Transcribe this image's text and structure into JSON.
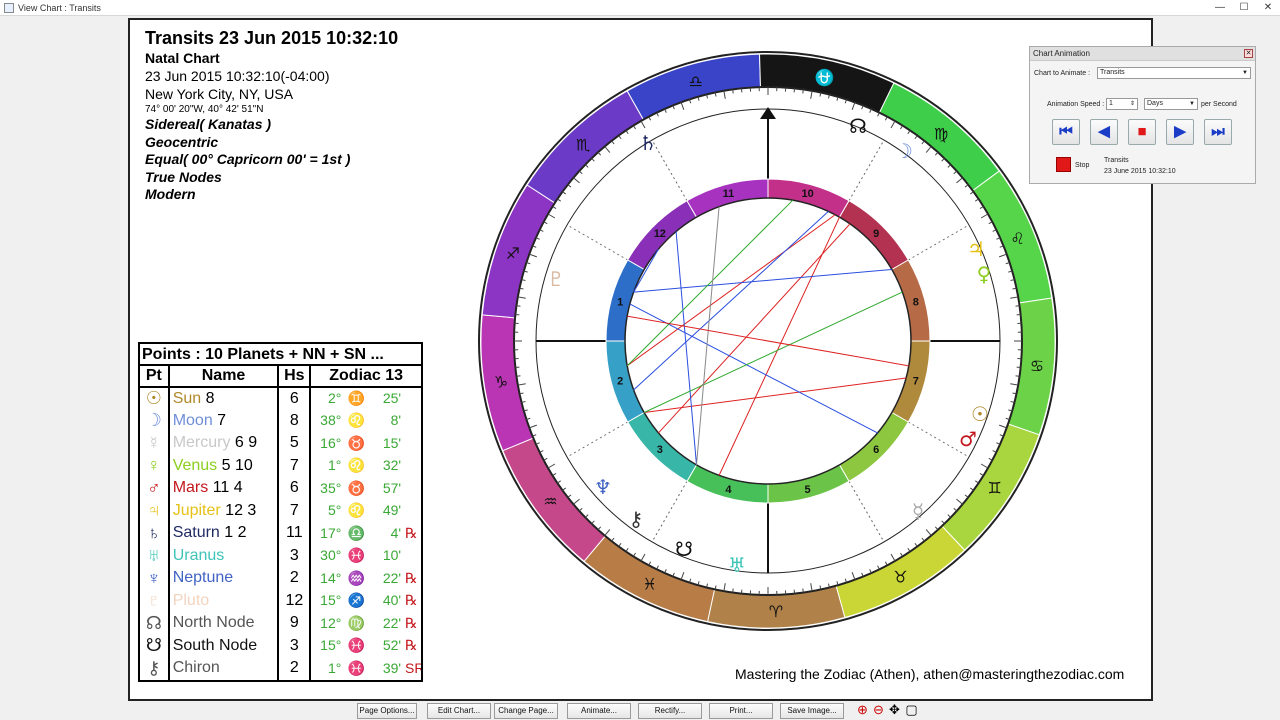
{
  "window": {
    "title": "View Chart : Transits",
    "minimize": "—",
    "maximize": "☐",
    "close": "✕"
  },
  "header": {
    "title": "Transits 23 Jun 2015 10:32:10",
    "subtitle": "Natal Chart",
    "datetime": "23 Jun 2015 10:32:10(-04:00)",
    "location": "New York City, NY, USA",
    "coords": "74° 00' 20\"W, 40° 42' 51\"N",
    "zodiac": "Sidereal( Kanatas )",
    "centric": "Geocentric",
    "houses": "Equal( 00° Capricorn 00' = 1st )",
    "nodes": "True Nodes",
    "style": "Modern"
  },
  "points": {
    "title": "Points : 10 Planets + NN + SN ...",
    "headers": [
      "Pt",
      "Name",
      "Hs",
      "Zodiac 13"
    ],
    "rows": [
      {
        "glyph": "☉",
        "name": "Sun",
        "extra": "8",
        "hs": "6",
        "deg": "2°",
        "sign": "♊",
        "min": "25'",
        "retro": "",
        "color": "#b08a2a"
      },
      {
        "glyph": "☽",
        "name": "Moon",
        "extra": "7",
        "hs": "8",
        "deg": "38°",
        "sign": "♌",
        "min": "8'",
        "retro": "",
        "color": "#6f8fd8"
      },
      {
        "glyph": "☿",
        "name": "Mercury",
        "extra": "6 9",
        "hs": "5",
        "deg": "16°",
        "sign": "♉",
        "min": "15'",
        "retro": "",
        "color": "#c8c8c8"
      },
      {
        "glyph": "♀",
        "name": "Venus",
        "extra": "5 10",
        "hs": "7",
        "deg": "1°",
        "sign": "♌",
        "min": "32'",
        "retro": "",
        "color": "#8ccf1e"
      },
      {
        "glyph": "♂",
        "name": "Mars",
        "extra": "11 4",
        "hs": "6",
        "deg": "35°",
        "sign": "♉",
        "min": "57'",
        "retro": "",
        "color": "#c4171d"
      },
      {
        "glyph": "♃",
        "name": "Jupiter",
        "extra": "12 3",
        "hs": "7",
        "deg": "5°",
        "sign": "♌",
        "min": "49'",
        "retro": "",
        "color": "#e6c117"
      },
      {
        "glyph": "♄",
        "name": "Saturn",
        "extra": "1 2",
        "hs": "11",
        "deg": "17°",
        "sign": "♎",
        "min": "4'",
        "retro": "℞",
        "color": "#1f2a63"
      },
      {
        "glyph": "♅",
        "name": "Uranus",
        "extra": "",
        "hs": "3",
        "deg": "30°",
        "sign": "♓",
        "min": "10'",
        "retro": "",
        "color": "#3fc4b8"
      },
      {
        "glyph": "♆",
        "name": "Neptune",
        "extra": "",
        "hs": "2",
        "deg": "14°",
        "sign": "♒",
        "min": "22'",
        "retro": "℞",
        "color": "#4063c4"
      },
      {
        "glyph": "♇",
        "name": "Pluto",
        "extra": "",
        "hs": "12",
        "deg": "15°",
        "sign": "♐",
        "min": "40'",
        "retro": "℞",
        "color": "#f1d4c0"
      },
      {
        "glyph": "☊",
        "name": "North Node",
        "extra": "",
        "hs": "9",
        "deg": "12°",
        "sign": "♍",
        "min": "22'",
        "retro": "℞",
        "color": "#555555"
      },
      {
        "glyph": "☋",
        "name": "South Node",
        "extra": "",
        "hs": "3",
        "deg": "15°",
        "sign": "♓",
        "min": "52'",
        "retro": "℞",
        "color": "#111111"
      },
      {
        "glyph": "⚷",
        "name": "Chiron",
        "extra": "",
        "hs": "2",
        "deg": "1°",
        "sign": "♓",
        "min": "39'",
        "retro": "SR",
        "color": "#555555"
      }
    ]
  },
  "wheel": {
    "outer_signs": [
      "♍",
      "♌",
      "♋",
      "♊",
      "♉",
      "♈",
      "♓",
      "♒",
      "♑",
      "♐",
      "♏",
      "♎",
      "⛎"
    ],
    "house_numbers": [
      "10",
      "9",
      "8",
      "7",
      "6",
      "5",
      "4",
      "3",
      "2",
      "1",
      "12",
      "11"
    ],
    "sign_colors": [
      "#3fce4a",
      "#56d44a",
      "#6cd348",
      "#a9d63f",
      "#c9d636",
      "#b0824a",
      "#b87c47",
      "#c4488a",
      "#b935b4",
      "#8c35c4",
      "#6b3ac6",
      "#3a44c8",
      "#151515"
    ]
  },
  "credit": "Mastering the Zodiac (Athen), athen@masteringthezodiac.com",
  "animation": {
    "title": "Chart Animation",
    "chart_to_animate_label": "Chart to Animate :",
    "chart_to_animate_value": "Transits",
    "speed_label": "Animation Speed :",
    "speed_value": "1",
    "unit_value": "Days",
    "per_second": "per Second",
    "stop_label": "Stop",
    "status_title": "Transits",
    "status_date": "23 June 2015 10:32:10",
    "buttons": [
      "⏮",
      "◀",
      "■",
      "▶",
      "⏭"
    ]
  },
  "bottom_buttons": [
    "Page Options...",
    "Edit Chart...",
    "Change Page...",
    "Animate...",
    "Rectify...",
    "Print...",
    "Save Image..."
  ]
}
